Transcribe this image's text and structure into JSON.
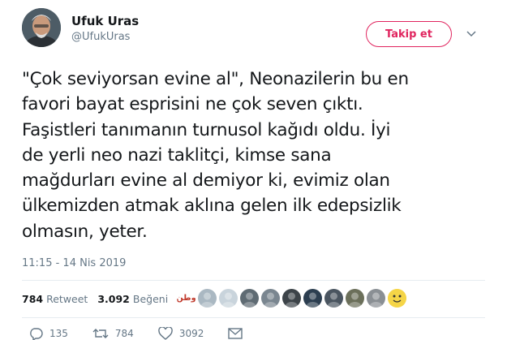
{
  "author": {
    "name": "Ufuk Uras",
    "handle": "@UfukUras"
  },
  "follow_label": "Takip et",
  "tweet": {
    "lines": [
      "\"Çok seviyorsan evine al\", Neonazilerin bu en",
      "favori bayat esprisini ne çok seven çıktı.",
      "Faşistleri tanımanın turnusol kağıdı oldu. İyi",
      "de yerli neo nazi taklitçi, kimse sana",
      "mağdurları evine al demiyor ki, evimiz olan",
      "ülkemizden atmak aklına gelen ilk edepsizlik",
      "olmasın, yeter."
    ],
    "timestamp": "11:15 - 14 Nis 2019"
  },
  "stats": {
    "retweet_count": "784",
    "retweet_label": "Retweet",
    "like_count": "3.092",
    "like_label": "Beğeni"
  },
  "likers": [
    {
      "icon": "arabic-text-avatar",
      "color": "#ffffff",
      "text": "وطن"
    },
    {
      "icon": "default-avatar",
      "color": "#aab8c2"
    },
    {
      "icon": "cartoon-avatar",
      "color": "#c9d4dc"
    },
    {
      "icon": "photo-avatar",
      "color": "#5f6b73"
    },
    {
      "icon": "photo-avatar",
      "color": "#7a8690"
    },
    {
      "icon": "photo-avatar",
      "color": "#3d4449"
    },
    {
      "icon": "photo-avatar",
      "color": "#2c3e50"
    },
    {
      "icon": "photo-avatar",
      "color": "#4a5560"
    },
    {
      "icon": "photo-avatar",
      "color": "#6b6f5a"
    },
    {
      "icon": "photo-avatar",
      "color": "#8a8f94"
    },
    {
      "icon": "emoji-avatar",
      "color": "#f5d547"
    }
  ],
  "actions": {
    "reply_count": "135",
    "retweet_count": "784",
    "like_count": "3092"
  },
  "colors": {
    "accent": "#e0245e",
    "secondary_text": "#657786",
    "divider": "#e6ecf0"
  }
}
